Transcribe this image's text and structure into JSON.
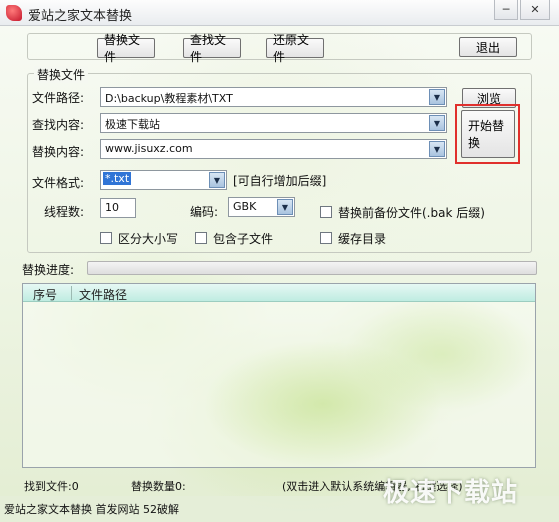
{
  "window": {
    "title": "爱站之家文本替换",
    "minimize_icon": "─",
    "close_icon": "✕"
  },
  "toolbar": {
    "replace_file": "替换文件",
    "find_file": "查找文件",
    "restore_file": "还原文件",
    "exit": "退出"
  },
  "group": {
    "legend": "替换文件"
  },
  "form": {
    "file_path_label": "文件路径:",
    "file_path_value": "D:\\backup\\教程素材\\TXT",
    "find_label": "查找内容:",
    "find_value": "极速下载站",
    "replace_label": "替换内容:",
    "replace_value": "www.jisuxz.com",
    "format_label": "文件格式:",
    "format_value": "*.txt",
    "format_hint": "[可自行增加后缀]",
    "threads_label": "线程数:",
    "threads_value": "10",
    "encoding_label": "编码:",
    "encoding_value": "GBK",
    "backup_label": "替换前备份文件(.bak 后缀)",
    "case_label": "区分大小写",
    "subdir_label": "包含子文件",
    "cache_label": "缓存目录",
    "browse": "浏览",
    "start": "开始替换",
    "arrow_icon": "▼"
  },
  "progress": {
    "label": "替换进度:",
    "value": 0
  },
  "list": {
    "columns": [
      "序号",
      "文件路径"
    ]
  },
  "status": {
    "found": "找到文件:0",
    "replaced": "替换数量0:",
    "hint": "(双击进入默认系统编辑器, 右键选择)"
  },
  "footer": {
    "text": "爱站之家文本替换 首发网站 52破解",
    "watermark": "极速下载站"
  },
  "colors": {
    "highlight": "#e0302c",
    "list_header": "#bfece1"
  }
}
